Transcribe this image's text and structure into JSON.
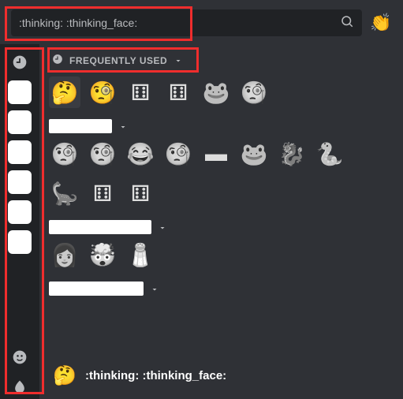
{
  "search": {
    "value": ":thinking: :thinking_face:"
  },
  "skin_tone_glyph": "👏",
  "sections": {
    "frequently_used": {
      "label": "Frequently Used"
    }
  },
  "emojis": {
    "row1": [
      "🤔",
      "🧐",
      "⚅",
      "⚅",
      "🐸",
      "🧐"
    ],
    "row2": [
      "🧐",
      "🧐",
      "😂",
      "🧐",
      "▬",
      "🐸",
      "🐉",
      "🐍"
    ],
    "row3": [
      "🦕",
      "⚅",
      "⚅"
    ],
    "row4": [
      "👩",
      "🤯",
      "🧂"
    ]
  },
  "server_groups": [
    {
      "chip_width": 80
    },
    {
      "chip_width": 130
    },
    {
      "chip_width": 120
    }
  ],
  "preview": {
    "glyph": "🤔",
    "code": ":thinking: :thinking_face:"
  }
}
